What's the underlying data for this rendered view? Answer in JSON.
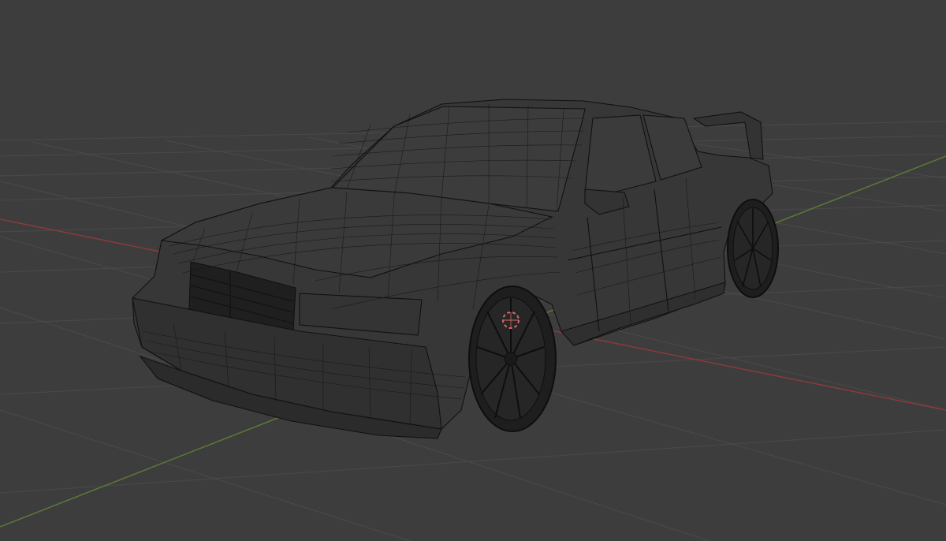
{
  "viewport": {
    "background_color": "#3d3d3d",
    "grid_line_color": "#4a4a4a",
    "x_axis_color": "#8a3b3b",
    "y_axis_color": "#5b7a38",
    "wire_color": "#111111",
    "wire_fill_color": "#3a3a3a",
    "origin_marker_color": "#d26a6a",
    "shading": "wireframe",
    "object": {
      "name": "car",
      "icon": "wireframe-mesh"
    },
    "gizmos": [
      "3d-cursor-icon"
    ]
  }
}
